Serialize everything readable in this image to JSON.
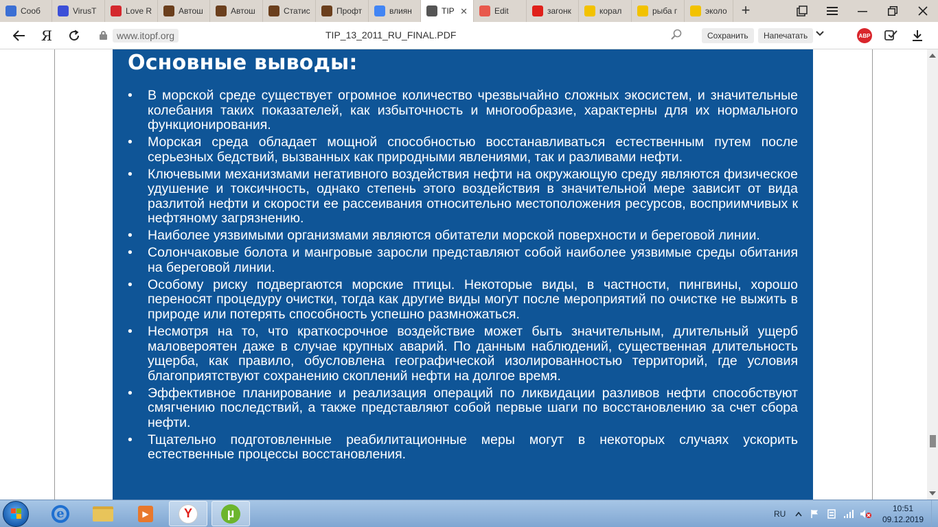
{
  "tabs": [
    {
      "label": "Сооб",
      "favicon": "message-icon",
      "color": "#3b6fd4"
    },
    {
      "label": "VirusT",
      "favicon": "virustotal-icon",
      "color": "#3c4fd8"
    },
    {
      "label": "Love R",
      "favicon": "loveread-icon",
      "color": "#d4282e"
    },
    {
      "label": "Автош",
      "favicon": "site-icon",
      "color": "#6b3f1d"
    },
    {
      "label": "Автош",
      "favicon": "site-icon",
      "color": "#6b3f1d"
    },
    {
      "label": "Статис",
      "favicon": "site-icon",
      "color": "#6b3f1d"
    },
    {
      "label": "Профт",
      "favicon": "site-icon",
      "color": "#6b3f1d"
    },
    {
      "label": "влиян",
      "favicon": "google-icon",
      "color": "#4285f4"
    },
    {
      "label": "TIP",
      "favicon": "pdf-icon",
      "color": "#555555",
      "active": true
    },
    {
      "label": "Edit",
      "favicon": "edit-icon",
      "color": "#e8584c"
    },
    {
      "label": "загонк",
      "favicon": "yandex-icon",
      "color": "#e0201a"
    },
    {
      "label": "корал",
      "favicon": "yandex-images-icon",
      "color": "#f2c200"
    },
    {
      "label": "рыба г",
      "favicon": "yandex-images-icon",
      "color": "#f2c200"
    },
    {
      "label": "эколо",
      "favicon": "yandex-images-icon",
      "color": "#f2c200"
    }
  ],
  "address": {
    "domain": "www.itopf.org",
    "document_title": "TIP_13_2011_RU_FINAL.PDF",
    "save_label": "Сохранить",
    "print_label": "Напечатать",
    "adblock_label": "ABP",
    "browser_logo": "Я"
  },
  "document": {
    "heading": "Основные выводы:",
    "bullet_char": "•",
    "bullets": [
      "В морской среде существует огромное количество чрезвычайно сложных экосистем, и значительные колебания таких показателей, как избыточность и многообразие, характерны для их нормального функционирования.",
      "Морская среда обладает мощной способностью восстанавливаться естественным путем после серьезных бедствий, вызванных как природными явлениями, так и разливами нефти.",
      "Ключевыми механизмами негативного воздействия нефти на окружающую среду являются физическое удушение и токсичность, однако степень этого воздействия в значительной мере зависит от вида разлитой нефти и скорости ее рассеивания относительно местоположения ресурсов, восприимчивых к нефтяному загрязнению.",
      "Наиболее уязвимыми организмами являются обитатели морской поверхности и береговой линии.",
      "Солончаковые болота и мангровые заросли представляют собой наиболее уязвимые среды обитания на береговой линии.",
      "Особому риску подвергаются морские птицы. Некоторые виды, в частности, пингвины, хорошо переносят процедуру очистки, тогда как другие виды могут после мероприятий по очистке не выжить в природе или потерять способность успешно размножаться.",
      "Несмотря на то, что краткосрочное воздействие может быть значительным, длительный ущерб маловероятен даже в случае крупных аварий. По данным наблюдений, существенная длительность ущерба, как правило, обусловлена географической изолированностью территорий, где условия благоприятствуют сохранению скоплений нефти на долгое время.",
      "Эффективное планирование и реализация операций по ликвидации разливов нефти способствуют смягчению последствий, а также представляют собой первые шаги по восстановлению за счет сбора нефти.",
      "Тщательно подготовленные реабилитационные меры могут в некоторых случаях ускорить естественные процессы восстановления."
    ]
  },
  "taskbar": {
    "language": "RU",
    "time": "10:51",
    "date": "09.12.2019",
    "yandex_letter": "Y",
    "utorrent_letter": "µ"
  },
  "colors": {
    "panel_blue": "#0f5597",
    "text_white": "#ffffff"
  }
}
